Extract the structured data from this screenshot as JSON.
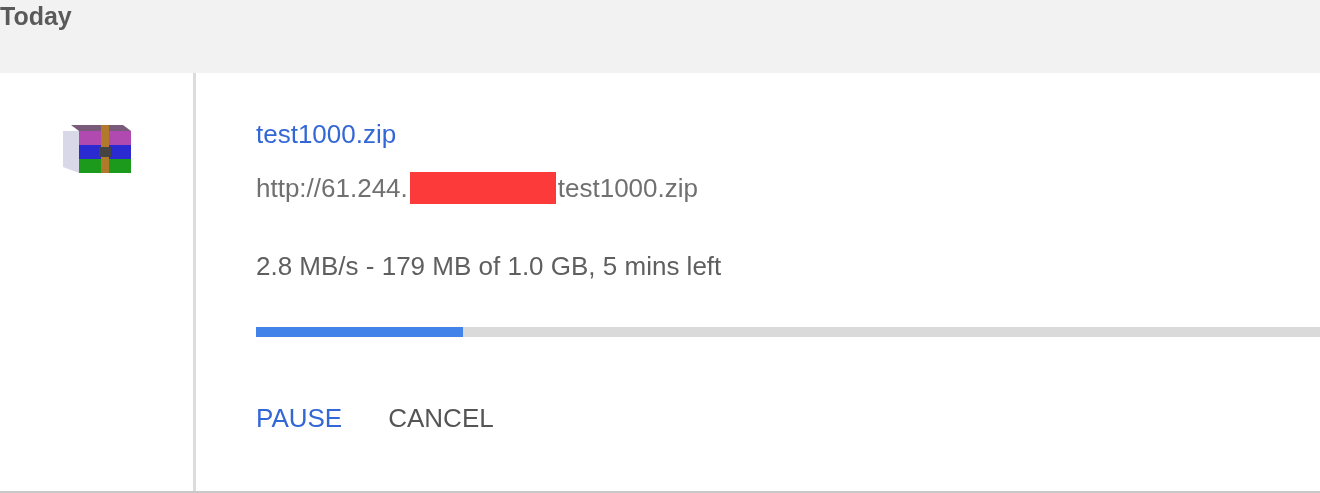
{
  "section": {
    "title": "Today"
  },
  "download": {
    "file_name": "test1000.zip",
    "url_start": "http://61.244.",
    "url_end": "test1000.zip",
    "status": "2.8 MB/s - 179 MB of 1.0 GB, 5 mins left",
    "progress": {
      "level": 0.195
    },
    "actions": [
      {
        "label": "PAUSE",
        "kind": "primary"
      },
      {
        "label": "CANCEL",
        "kind": "secondary"
      }
    ]
  }
}
